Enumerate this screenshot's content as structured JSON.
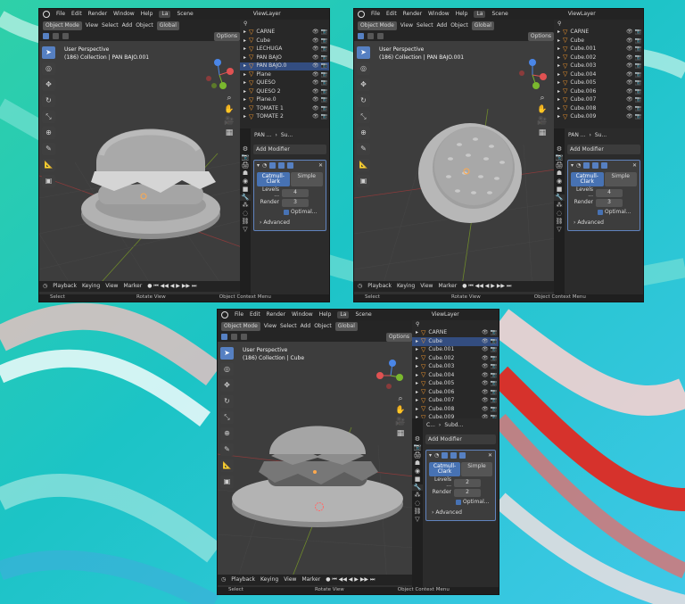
{
  "colors": {
    "accent": "#4772b3",
    "selected": "#334d80",
    "object_orange": "#ff9e2e"
  },
  "windows": [
    {
      "menu": [
        "File",
        "Edit",
        "Render",
        "Window",
        "Help"
      ],
      "workspace": "La",
      "scene": "Scene",
      "view_layer": "ViewLayer",
      "mode": "Object Mode",
      "view_menu": [
        "View",
        "Select",
        "Add",
        "Object"
      ],
      "orientation": "Global",
      "options": "Options",
      "perspective": "User Perspective",
      "collection_info": "(186) Collection | PAN BAJO.001",
      "outliner": [
        "CARNE",
        "Cube",
        "LECHUGA",
        "PAN BAJO",
        "PAN BAJO.0",
        "Plane",
        "QUESO",
        "QUESO 2",
        "Plane.0",
        "TOMATE 1",
        "TOMATE 2"
      ],
      "outliner_selected": 4,
      "breadcrumb": [
        "PAN ...",
        "Su..."
      ],
      "add_modifier": "Add Modifier",
      "mod_tabs": [
        "Catmull-Clark",
        "Simple"
      ],
      "levels_label": "Levels ...",
      "levels": "4",
      "render_label": "Render",
      "render": "3",
      "optimal": "Optimal...",
      "advanced": "Advanced",
      "timeline": [
        "Playback",
        "Keying",
        "View",
        "Marker"
      ],
      "status": [
        "Select",
        "Rotate View",
        "Object Context Menu"
      ]
    },
    {
      "menu": [
        "File",
        "Edit",
        "Render",
        "Window",
        "Help"
      ],
      "workspace": "La",
      "scene": "Scene",
      "view_layer": "ViewLayer",
      "mode": "Object Mode",
      "view_menu": [
        "View",
        "Select",
        "Add",
        "Object"
      ],
      "orientation": "Global",
      "options": "Options",
      "perspective": "User Perspective",
      "collection_info": "(186) Collection | PAN BAJO.001",
      "outliner": [
        "CARNE",
        "Cube",
        "Cube.001",
        "Cube.002",
        "Cube.003",
        "Cube.004",
        "Cube.005",
        "Cube.006",
        "Cube.007",
        "Cube.008",
        "Cube.009"
      ],
      "outliner_selected": -1,
      "breadcrumb": [
        "PAN ...",
        "Su..."
      ],
      "add_modifier": "Add Modifier",
      "mod_tabs": [
        "Catmull-Clark",
        "Simple"
      ],
      "levels_label": "Levels ...",
      "levels": "4",
      "render_label": "Render",
      "render": "3",
      "optimal": "Optimal...",
      "advanced": "Advanced",
      "timeline": [
        "Playback",
        "Keying",
        "View",
        "Marker"
      ],
      "status": [
        "Select",
        "Rotate View",
        "Object Context Menu"
      ]
    },
    {
      "menu": [
        "File",
        "Edit",
        "Render",
        "Window",
        "Help"
      ],
      "workspace": "La",
      "scene": "Scene",
      "view_layer": "ViewLayer",
      "mode": "Object Mode",
      "view_menu": [
        "View",
        "Select",
        "Add",
        "Object"
      ],
      "orientation": "Global",
      "options": "Options",
      "perspective": "User Perspective",
      "collection_info": "(186) Collection | Cube",
      "outliner": [
        "CARNE",
        "Cube",
        "Cube.001",
        "Cube.002",
        "Cube.003",
        "Cube.004",
        "Cube.005",
        "Cube.006",
        "Cube.007",
        "Cube.008",
        "Cube.009"
      ],
      "outliner_selected": 1,
      "breadcrumb": [
        "C...",
        "Subd..."
      ],
      "add_modifier": "Add Modifier",
      "mod_tabs": [
        "Catmull-Clark",
        "Simple"
      ],
      "levels_label": "Levels ...",
      "levels": "2",
      "render_label": "Render",
      "render": "2",
      "optimal": "Optimal...",
      "advanced": "Advanced",
      "timeline": [
        "Playback",
        "Keying",
        "View",
        "Marker"
      ],
      "status": [
        "Select",
        "Rotate View",
        "Object Context Menu"
      ]
    }
  ]
}
